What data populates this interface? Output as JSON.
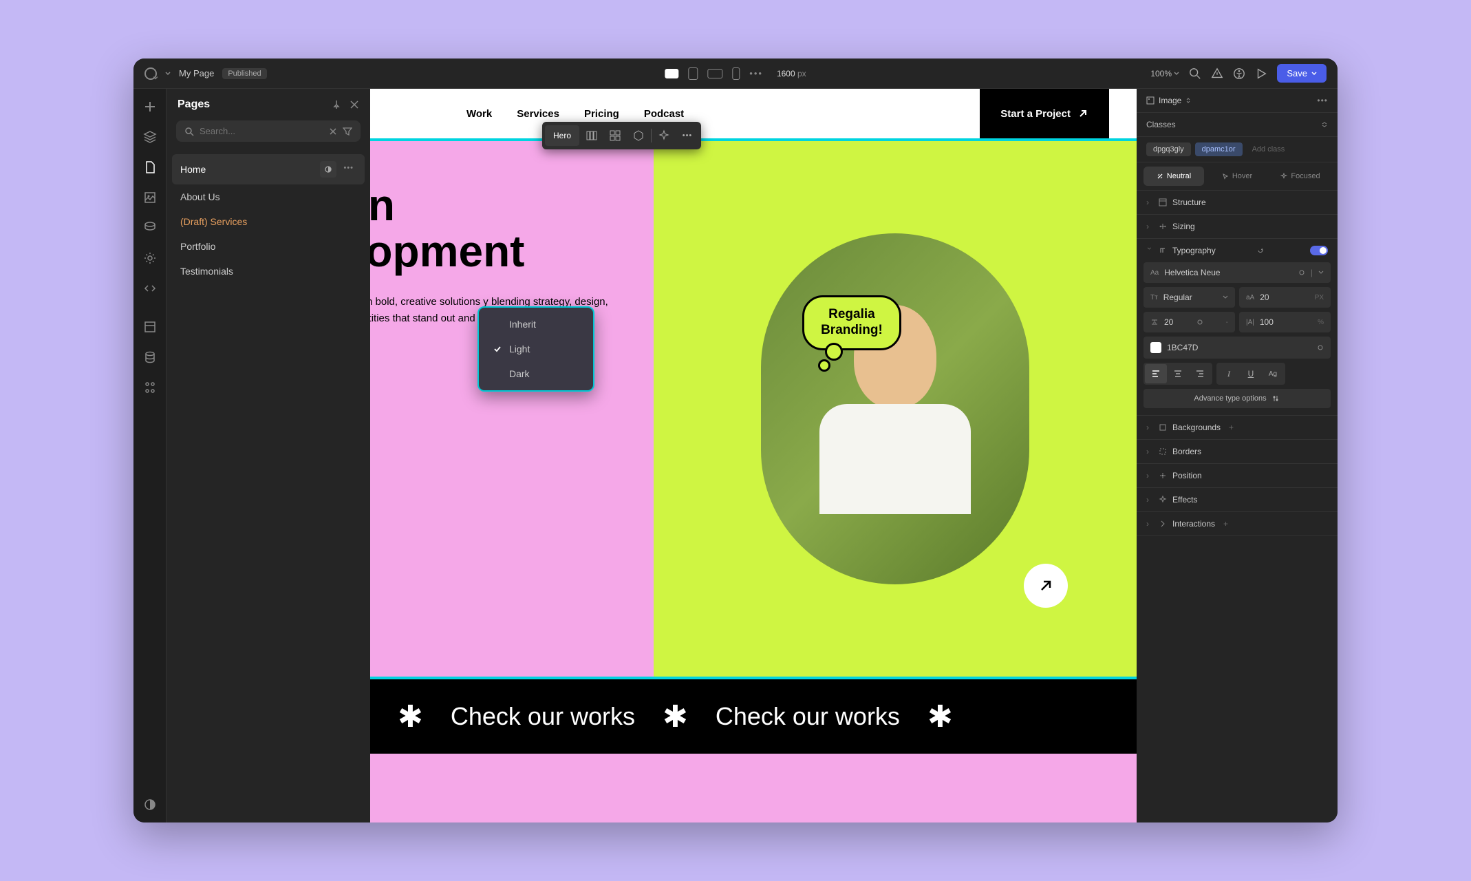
{
  "topbar": {
    "project_name": "My Page",
    "status_badge": "Published",
    "breakpoint_value": "1600",
    "breakpoint_unit": "px",
    "zoom": "100%",
    "save_label": "Save"
  },
  "left_panel": {
    "title": "Pages",
    "search_placeholder": "Search...",
    "pages": [
      {
        "label": "Home",
        "active": true
      },
      {
        "label": "About Us"
      },
      {
        "label": "(Draft) Services",
        "draft": true
      },
      {
        "label": "Portfolio"
      },
      {
        "label": "Testimonials"
      }
    ]
  },
  "theme_menu": {
    "options": [
      "Inherit",
      "Light",
      "Dark"
    ],
    "selected": "Light"
  },
  "canvas": {
    "nav_items": [
      "Work",
      "Services",
      "Pricing",
      "Podcast"
    ],
    "nav_cta": "Start a Project",
    "hero_title_line1": "ign",
    "hero_title_line2": "elopment",
    "hero_body": "ands with bold, creative solutions y blending strategy, design, and identities that stand out and d.",
    "speech_bubble_line1": "Regalia",
    "speech_bubble_line2": "Branding!",
    "marquee_text": "Check our works",
    "toolbar_label": "Hero"
  },
  "right_panel": {
    "element_type": "Image",
    "classes_label": "Classes",
    "class_pills": [
      "dpgq3gly",
      "dpamc1or"
    ],
    "add_class_placeholder": "Add class",
    "states": [
      "Neutral",
      "Hover",
      "Focused"
    ],
    "sections": {
      "structure": "Structure",
      "sizing": "Sizing",
      "typography": "Typography",
      "backgrounds": "Backgrounds",
      "borders": "Borders",
      "position": "Position",
      "effects": "Effects",
      "interactions": "Interactions"
    },
    "typography": {
      "font_family": "Helvetica Neue",
      "font_weight": "Regular",
      "font_size": "20",
      "font_size_unit": "PX",
      "line_height": "20",
      "letter_spacing": "100",
      "letter_spacing_unit": "%",
      "color_hex": "1BC47D",
      "advance_label": "Advance type options"
    }
  }
}
